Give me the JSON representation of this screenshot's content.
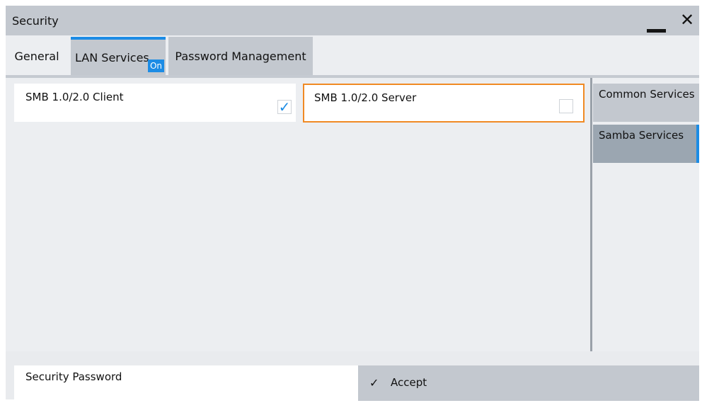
{
  "window": {
    "title": "Security",
    "minimize_icon": "minimize-icon",
    "close_icon": "close-icon"
  },
  "tabs": [
    {
      "label": "General",
      "active": false
    },
    {
      "label": "LAN Services",
      "active": true,
      "badge": "On"
    },
    {
      "label": "Password Management",
      "active": false
    }
  ],
  "settings": {
    "smb_client": {
      "label": "SMB 1.0/2.0 Client",
      "checked": true
    },
    "smb_server": {
      "label": "SMB 1.0/2.0 Server",
      "checked": false,
      "highlighted": true
    }
  },
  "side_nav": [
    {
      "label": "Common Services",
      "active": false
    },
    {
      "label": "Samba Services",
      "active": true
    }
  ],
  "footer": {
    "password_label": "Security Password",
    "accept_label": "Accept",
    "accept_icon": "checkmark-icon"
  },
  "colors": {
    "accent": "#1c8ce5",
    "highlight": "#f08a24",
    "panel": "#c3c8cf"
  }
}
